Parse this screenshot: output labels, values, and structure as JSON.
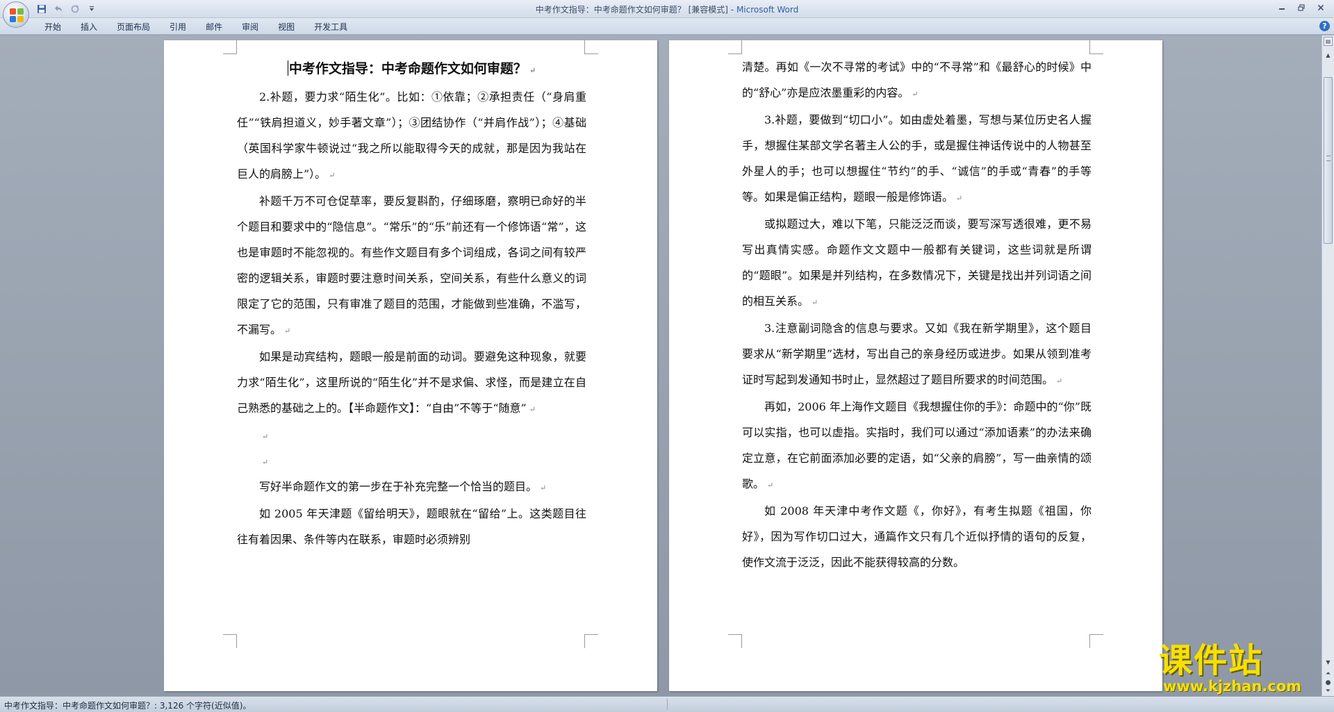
{
  "window": {
    "title_doc": "中考作文指导：中考命题作文如何审题？ [兼容模式]",
    "title_sep": " - ",
    "title_app": "Microsoft Word"
  },
  "quick_access": {
    "icons": [
      "save-icon",
      "undo-icon",
      "redo-icon",
      "customize-icon"
    ]
  },
  "ribbon": {
    "tabs": [
      "开始",
      "插入",
      "页面布局",
      "引用",
      "邮件",
      "审阅",
      "视图",
      "开发工具"
    ],
    "help": "?"
  },
  "document": {
    "page1": {
      "title": "中考作文指导：中考命题作文如何审题？",
      "paragraphs": [
        "2.补题，要力求“陌生化”。比如：①依靠；②承担责任（“身肩重任”“铁肩担道义，妙手著文章”）；③团结协作（“并肩作战”）；④基础（英国科学家牛顿说过“我之所以能取得今天的成就，那是因为我站在巨人的肩膀上”）。",
        "补题千万不可仓促草率，要反复斟酌，仔细琢磨，察明已命好的半个题目和要求中的“隐信息”。“常乐”的“乐”前还有一个修饰语“常”，这也是审题时不能忽视的。有些作文题目有多个词组成，各词之间有较严密的逻辑关系，审题时要注意时间关系，空间关系，有些什么意义的词限定了它的范围，只有审准了题目的范围，才能做到些准确，不滥写，不漏写。",
        "如果是动宾结构，题眼一般是前面的动词。要避免这种现象，就要力求“陌生化”，这里所说的“陌生化”并不是求偏、求怪，而是建立在自己熟悉的基础之上的。【半命题作文】：“自由”不等于“随意”"
      ],
      "paragraphs_after": [
        "写好半命题作文的第一步在于补充完整一个恰当的题目。",
        "如 2005 年天津题《留给明天》，题眼就在“留给”上。这类题目往往有着因果、条件等内在联系，审题时必须辨别"
      ]
    },
    "page2": {
      "paragraphs": [
        "清楚。再如《一次不寻常的考试》中的“不寻常”和《最舒心的时候》中的“舒心”亦是应浓墨重彩的内容。",
        "3.补题，要做到“切口小”。如由虚处着墨，写想与某位历史名人握手，想握住某部文学名著主人公的手，或是握住神话传说中的人物甚至外星人的手；也可以想握住“节约”的手、“诚信”的手或“青春”的手等等。如果是偏正结构，题眼一般是修饰语。",
        "或拟题过大，难以下笔，只能泛泛而谈，要写深写透很难，更不易写出真情实感。命题作文文题中一般都有关键词，这些词就是所谓的“题眼”。如果是并列结构，在多数情况下，关键是找出并列词语之间的相互关系。",
        "3.注意副词隐含的信息与要求。又如《我在新学期里》，这个题目要求从“新学期里”选材，写出自己的亲身经历或进步。如果从领到准考证时写起到发通知书时止，显然超过了题目所要求的时间范围。",
        "再如，2006 年上海作文题目《我想握住你的手》：命题中的“你”既可以实指，也可以虚指。实指时，我们可以通过“添加语素”的办法来确定立意，在它前面添加必要的定语，如“父亲的肩膀”，写一曲亲情的颂歌。",
        "如 2008 年天津中考作文题《，你好》，有考生拟题《祖国，你好》，因为写作切口过大，通篇作文只有几个近似抒情的语句的反复，使作文流于泛泛，因此不能获得较高的分数。"
      ]
    },
    "para_mark": "↵"
  },
  "statusbar": {
    "text": "中考作文指导：中考命题作文如何审题？: 3,126 个字符(近似值)。"
  },
  "watermark": {
    "cn": "课件站",
    "url": "www.kjzhan.com"
  },
  "colors": {
    "accent": "#2e5fa6",
    "watermark": "#f7e000",
    "workspace": "#9aa3af"
  }
}
